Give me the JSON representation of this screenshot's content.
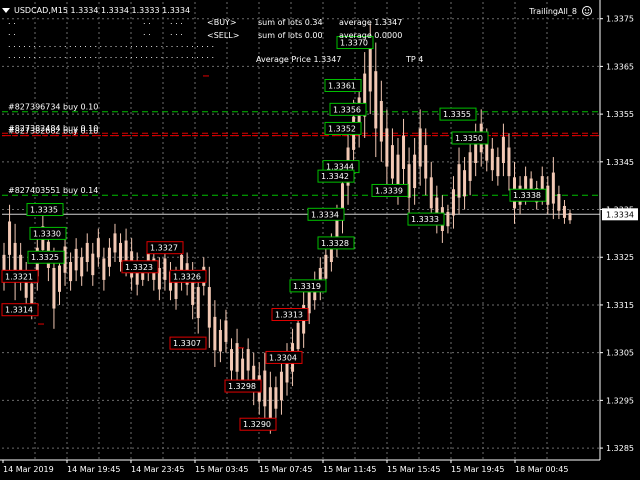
{
  "header": {
    "symbol_line": "USDCAD,M15  1.3334 1.3334 1.3333 1.3334",
    "expert_name": "TrailingAll_8",
    "dotted_lines": [
      ". .",
      ". .",
      ". . . . . . . . . . . . . . . . . . . . . . . . . . . . . . . . . . . . . . . . .",
      ". . . . . . . . . . . . . . . . . . . . . . . . . . . . . . . . . . . . . . . . ."
    ],
    "mid_dots": [
      ". .",
      ". .",
      ". . .",
      ". . ."
    ]
  },
  "stats": {
    "buy_label": "<BUY>",
    "sell_label": "<SELL>",
    "buy_lots": "sum of lots  0.34",
    "sell_lots": "sum of lots  0.00",
    "buy_avg": "average  1.3347",
    "sell_avg": "average  0.0000",
    "avg_price": "Average Price 1.3347",
    "tp": "TP 4"
  },
  "orders": [
    {
      "text": "#827396734 buy 0.10",
      "price": 1.33555
    },
    {
      "text": "#827382484 buy 0.10",
      "price": 1.3351
    },
    {
      "text": "#827382682 buy 0.10",
      "price": 1.33505
    },
    {
      "text": "#827403551 buy 0.14",
      "price": 1.3338
    }
  ],
  "colors": {
    "background": "#000000",
    "grid": "#6b6b6b",
    "candle": "#f2c8b4",
    "green": "#00c000",
    "red": "#e00000",
    "white": "#ffffff"
  },
  "chart_data": {
    "type": "candlestick",
    "symbol": "USDCAD",
    "timeframe": "M15",
    "ylim": [
      1.32825,
      1.33785
    ],
    "y_ticks": [
      "1.3375",
      "1.3365",
      "1.3355",
      "1.3345",
      "1.3335",
      "1.3325",
      "1.3315",
      "1.3305",
      "1.3295",
      "1.3285"
    ],
    "y_tick_values": [
      1.3375,
      1.3365,
      1.3355,
      1.3345,
      1.3335,
      1.3325,
      1.3315,
      1.3305,
      1.3295,
      1.3285
    ],
    "x_ticks": [
      "14 Mar 2019",
      "14 Mar 19:45",
      "14 Mar 23:45",
      "15 Mar 03:45",
      "15 Mar 07:45",
      "15 Mar 11:45",
      "15 Mar 15:45",
      "15 Mar 19:45",
      "18 Mar 00:45"
    ],
    "current_price": "1.3334",
    "current_price_value": 1.3334,
    "green_labels": [
      {
        "text": "1.3370",
        "price": 1.337
      },
      {
        "text": "1.3361",
        "price": 1.3361
      },
      {
        "text": "1.3356",
        "price": 1.3356
      },
      {
        "text": "1.3352",
        "price": 1.3352
      },
      {
        "text": "1.3344",
        "price": 1.3344
      },
      {
        "text": "1.3342",
        "price": 1.3342
      },
      {
        "text": "1.3339",
        "price": 1.3339
      },
      {
        "text": "1.3335",
        "price": 1.3335
      },
      {
        "text": "1.3334",
        "price": 1.3334
      },
      {
        "text": "1.3333",
        "price": 1.3333
      },
      {
        "text": "1.3330",
        "price": 1.333
      },
      {
        "text": "1.3328",
        "price": 1.3328
      },
      {
        "text": "1.3325",
        "price": 1.3325
      },
      {
        "text": "1.3319",
        "price": 1.3319
      },
      {
        "text": "1.3355",
        "price": 1.3355
      },
      {
        "text": "1.3350",
        "price": 1.335
      },
      {
        "text": "1.3338",
        "price": 1.3338
      }
    ],
    "red_labels": [
      {
        "text": "1.3327",
        "price": 1.3327
      },
      {
        "text": "1.3323",
        "price": 1.3323
      },
      {
        "text": "1.3326",
        "price": 1.3321
      },
      {
        "text": "1.3321",
        "price": 1.3321
      },
      {
        "text": "1.3314",
        "price": 1.3314
      },
      {
        "text": "1.3313",
        "price": 1.3313
      },
      {
        "text": "1.3307",
        "price": 1.3307
      },
      {
        "text": "1.3304",
        "price": 1.3304
      },
      {
        "text": "1.3298",
        "price": 1.3298
      },
      {
        "text": "1.3290",
        "price": 1.329
      }
    ],
    "candles_hl": [
      [
        1.3328,
        1.3318
      ],
      [
        1.3336,
        1.3322
      ],
      [
        1.3332,
        1.3316
      ],
      [
        1.3328,
        1.3318
      ],
      [
        1.3324,
        1.3314
      ],
      [
        1.3322,
        1.3312
      ],
      [
        1.333,
        1.3318
      ],
      [
        1.3334,
        1.3324
      ],
      [
        1.3331,
        1.332
      ],
      [
        1.3327,
        1.331
      ],
      [
        1.3326,
        1.3315
      ],
      [
        1.333,
        1.3319
      ],
      [
        1.3326,
        1.3318
      ],
      [
        1.3329,
        1.332
      ],
      [
        1.3327,
        1.3319
      ],
      [
        1.333,
        1.3322
      ],
      [
        1.3328,
        1.3319
      ],
      [
        1.3331,
        1.3323
      ],
      [
        1.3327,
        1.3318
      ],
      [
        1.3329,
        1.3321
      ],
      [
        1.3332,
        1.3324
      ],
      [
        1.333,
        1.3322
      ],
      [
        1.3331,
        1.3321
      ],
      [
        1.3329,
        1.3318
      ],
      [
        1.3326,
        1.3317
      ],
      [
        1.3324,
        1.3319
      ],
      [
        1.3328,
        1.332
      ],
      [
        1.3327,
        1.3318
      ],
      [
        1.3325,
        1.3316
      ],
      [
        1.3327,
        1.3318
      ],
      [
        1.3324,
        1.3316
      ],
      [
        1.3323,
        1.3314
      ],
      [
        1.3328,
        1.3318
      ],
      [
        1.3326,
        1.3317
      ],
      [
        1.3324,
        1.3312
      ],
      [
        1.3322,
        1.3309
      ],
      [
        1.3325,
        1.3317
      ],
      [
        1.3323,
        1.3306
      ],
      [
        1.3316,
        1.3302
      ],
      [
        1.3312,
        1.3303
      ],
      [
        1.3314,
        1.3305
      ],
      [
        1.3308,
        1.3299
      ],
      [
        1.331,
        1.3298
      ],
      [
        1.3306,
        1.3297
      ],
      [
        1.3308,
        1.3299
      ],
      [
        1.3305,
        1.3294
      ],
      [
        1.3303,
        1.3292
      ],
      [
        1.3305,
        1.329
      ],
      [
        1.3301,
        1.3288
      ],
      [
        1.33,
        1.3291
      ],
      [
        1.3304,
        1.3292
      ],
      [
        1.3307,
        1.3296
      ],
      [
        1.331,
        1.3298
      ],
      [
        1.3314,
        1.3303
      ],
      [
        1.3318,
        1.3306
      ],
      [
        1.332,
        1.3311
      ],
      [
        1.3322,
        1.3314
      ],
      [
        1.3325,
        1.3316
      ],
      [
        1.3328,
        1.3318
      ],
      [
        1.333,
        1.3322
      ],
      [
        1.3336,
        1.3325
      ],
      [
        1.3344,
        1.333
      ],
      [
        1.3352,
        1.3336
      ],
      [
        1.3358,
        1.3344
      ],
      [
        1.3362,
        1.3348
      ],
      [
        1.3368,
        1.335
      ],
      [
        1.3374,
        1.3355
      ],
      [
        1.337,
        1.3346
      ],
      [
        1.3362,
        1.3345
      ],
      [
        1.3356,
        1.334
      ],
      [
        1.3352,
        1.3338
      ],
      [
        1.335,
        1.3336
      ],
      [
        1.3354,
        1.334
      ],
      [
        1.3348,
        1.3334
      ],
      [
        1.335,
        1.3336
      ],
      [
        1.3356,
        1.334
      ],
      [
        1.3352,
        1.3338
      ],
      [
        1.3345,
        1.3332
      ],
      [
        1.334,
        1.333
      ],
      [
        1.3338,
        1.3328
      ],
      [
        1.3336,
        1.333
      ],
      [
        1.3342,
        1.3331
      ],
      [
        1.3348,
        1.3334
      ],
      [
        1.3346,
        1.3335
      ],
      [
        1.335,
        1.3338
      ],
      [
        1.3353,
        1.3342
      ],
      [
        1.3356,
        1.3344
      ],
      [
        1.3352,
        1.3343
      ],
      [
        1.335,
        1.3341
      ],
      [
        1.3348,
        1.334
      ],
      [
        1.3353,
        1.3342
      ],
      [
        1.3351,
        1.3339
      ],
      [
        1.3345,
        1.3332
      ],
      [
        1.3342,
        1.3334
      ],
      [
        1.3344,
        1.3336
      ],
      [
        1.3343,
        1.3337
      ],
      [
        1.3341,
        1.3335
      ],
      [
        1.3344,
        1.3336
      ],
      [
        1.3342,
        1.3334
      ],
      [
        1.3346,
        1.3333
      ],
      [
        1.334,
        1.3333
      ],
      [
        1.3337,
        1.3332
      ],
      [
        1.3335,
        1.3332
      ]
    ]
  }
}
